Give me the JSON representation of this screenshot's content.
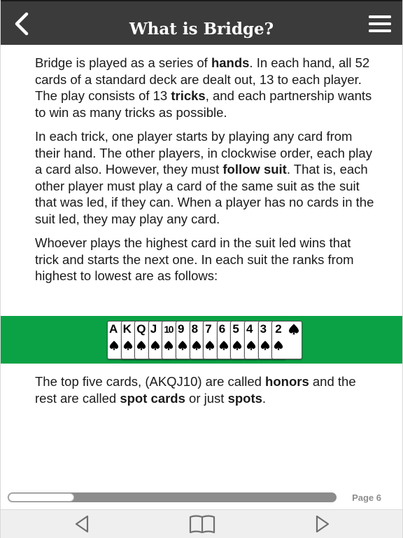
{
  "header": {
    "title": "What is Bridge?",
    "back_icon": "chevron-left-icon",
    "menu_icon": "hamburger-menu-icon"
  },
  "content": {
    "p1": {
      "t1": "Bridge is played as a series of ",
      "b1": "hands",
      "t2": ". In each hand, all 52 cards of a standard deck are dealt out, 13 to each player. The play consists of 13 ",
      "b2": "tricks",
      "t3": ", and each partnership wants to win as many tricks as possible."
    },
    "p2": {
      "t1": "In each trick, one player starts by playing any card from their hand. The other players, in clockwise order, each play a card also. However, they must ",
      "b1": "follow suit",
      "t2": ". That is, each other player must play a card of the same suit as the suit that was led, if they can. When a player has no cards in the suit led, they may play any card."
    },
    "p3": {
      "t1": "Whoever plays the highest card in the suit led wins that trick and starts the next one. In each suit the ranks from highest to lowest are as follows:"
    },
    "cards": {
      "suit_icon": "spade-icon",
      "ranks": [
        "A",
        "K",
        "Q",
        "J",
        "10",
        "9",
        "8",
        "7",
        "6",
        "5",
        "4",
        "3",
        "2"
      ]
    },
    "p4": {
      "t1": "The top five cards, (AKQJ10) are called ",
      "b1": "honors",
      "t2": " and the rest are called ",
      "b2": "spot cards",
      "t3": " or just ",
      "b3": "spots",
      "t4": "."
    }
  },
  "progress": {
    "fraction": 0.2,
    "page_label": "Page 6"
  },
  "bottom_nav": {
    "prev_icon": "triangle-left-icon",
    "book_icon": "open-book-icon",
    "next_icon": "triangle-right-icon"
  },
  "colors": {
    "header_bg": "#3b3b3b",
    "band_green": "#0aa245",
    "nav_bg": "#efefef"
  }
}
